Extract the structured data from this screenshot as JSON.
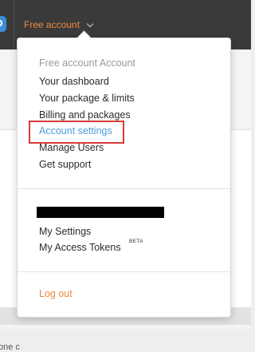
{
  "header": {
    "account_toggle_label": "Free account",
    "account_toggle_icon": "chevron-down-icon",
    "accent_color": "#f0883e"
  },
  "background": {
    "snippet_text": "one c"
  },
  "dropdown": {
    "account_section": {
      "header": "Free account Account",
      "items": [
        {
          "label": "Your dashboard"
        },
        {
          "label": "Your package & limits"
        },
        {
          "label": "Billing and packages"
        },
        {
          "label": "Account settings",
          "highlighted": true
        },
        {
          "label": "Manage Users"
        },
        {
          "label": "Get support"
        }
      ]
    },
    "user_section": {
      "username_redacted": true,
      "items": [
        {
          "label": "My Settings"
        },
        {
          "label": "My Access Tokens",
          "badge": "BETA"
        }
      ]
    },
    "logout_label": "Log out",
    "highlight_color": "#4a9fd8",
    "annotation_color": "#d93a3a"
  }
}
